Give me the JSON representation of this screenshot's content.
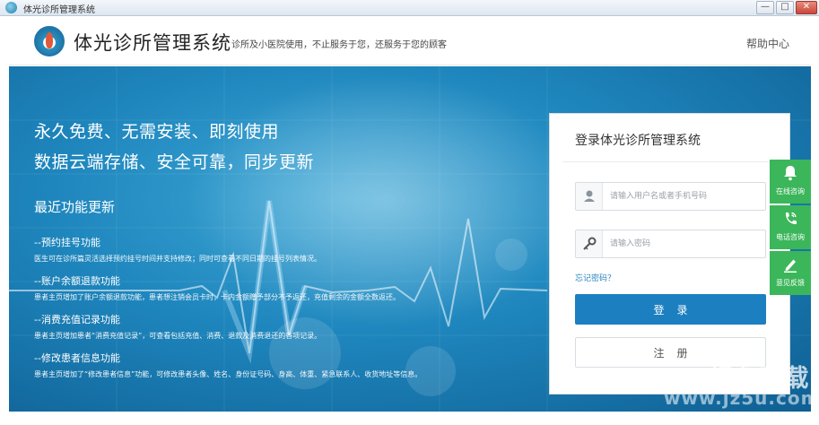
{
  "window": {
    "title": "体光诊所管理系统",
    "minimize_label": "—",
    "maximize_label": "□",
    "close_label": "✕"
  },
  "header": {
    "brand": "体光诊所管理系统",
    "slogan": "诊所及小医院使用，不止服务于您，还服务于您的顾客",
    "help_label": "帮助中心"
  },
  "banner": {
    "headline_1": "永久免费、无需安装、即刻使用",
    "headline_2": "数据云端存储、安全可靠，同步更新",
    "updates_title": "最近功能更新",
    "updates": [
      {
        "title": "--预约挂号功能",
        "desc": "医生可在诊所篇灵活选择预约挂号时间并支持修改；同时可查看不同日期的挂号列表情况。"
      },
      {
        "title": "--账户余额退款功能",
        "desc": "患者主页增加了账户余额退款功能，患者想注销会员卡时，卡内金额赠予部分不予返还，充值剩余的金额全数返还。"
      },
      {
        "title": "--消费充值记录功能",
        "desc": "患者主页增加患者“消费充值记录”，可查看包括充值、消费、退款及消费退还的各项记录。"
      },
      {
        "title": "--修改患者信息功能",
        "desc": "患者主页增加了“修改患者信息”功能，可修改患者头像、姓名、身份证号码、身高、体重、紧急联系人、收货地址等信息。"
      }
    ]
  },
  "login": {
    "title": "登录体光诊所管理系统",
    "username_placeholder": "请输入用户名或者手机号码",
    "username_value": "",
    "password_placeholder": "请输入密码",
    "password_value": "",
    "forgot_label": "忘记密码？",
    "login_label": "登录",
    "register_label": "注册"
  },
  "side_service": [
    {
      "icon": "bell-icon",
      "label": "在线咨询"
    },
    {
      "icon": "phone-icon",
      "label": "电话咨询"
    },
    {
      "icon": "pencil-icon",
      "label": "意见反馈"
    }
  ],
  "watermark": {
    "main": "JZ5U绿色下载",
    "url": "www.jz5u.com"
  },
  "colors": {
    "banner": "#1e86bd",
    "primary_button": "#1c7fc0",
    "side_green": "#3cb65a",
    "link": "#2a86c2"
  }
}
